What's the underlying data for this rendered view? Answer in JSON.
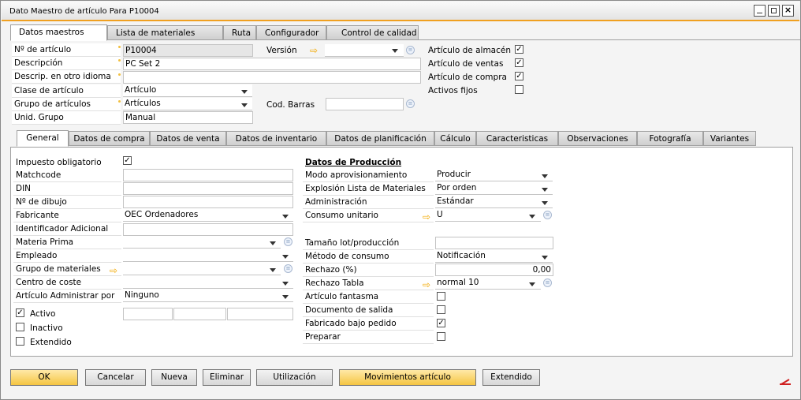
{
  "window": {
    "title": "Dato Maestro de artículo Para P10004"
  },
  "top_tabs": [
    "Datos maestros",
    "Lista de materiales",
    "Ruta",
    "Configurador",
    "Control de calidad"
  ],
  "header": {
    "item_no_label": "Nº de artículo",
    "item_no": "P10004",
    "version_label": "Versión",
    "version": "",
    "desc_label": "Descripción",
    "desc": "PC Set 2",
    "desc_other_label": "Descrip. en otro idioma",
    "desc_other": "",
    "item_class_label": "Clase de artículo",
    "item_class": "Artículo",
    "item_group_label": "Grupo de artículos",
    "item_group": "Artículos",
    "barcode_label": "Cod. Barras",
    "barcode": "",
    "uom_group_label": "Unid. Grupo",
    "uom_group": "Manual",
    "inventory_item_label": "Artículo de almacén",
    "inventory_item": true,
    "sales_item_label": "Artículo de ventas",
    "sales_item": true,
    "purchase_item_label": "Artículo de compra",
    "purchase_item": true,
    "fixed_assets_label": "Activos fijos",
    "fixed_assets": false
  },
  "sub_tabs": [
    "General",
    "Datos de compra",
    "Datos de venta",
    "Datos de inventario",
    "Datos de planificación",
    "Cálculo",
    "Caracteristicas",
    "Observaciones",
    "Fotografía",
    "Variantes"
  ],
  "general": {
    "tax_label": "Impuesto obligatorio",
    "tax": true,
    "matchcode_label": "Matchcode",
    "matchcode": "",
    "din_label": "DIN",
    "din": "",
    "drawing_label": "Nº de dibujo",
    "drawing": "",
    "manufacturer_label": "Fabricante",
    "manufacturer": "OEC Ordenadores",
    "add_id_label": "Identificador Adicional",
    "add_id": "",
    "raw_material_label": "Materia Prima",
    "raw_material": "",
    "employee_label": "Empleado",
    "employee": "",
    "material_group_label": "Grupo de materiales",
    "material_group": "",
    "cost_center_label": "Centro de coste",
    "cost_center": "",
    "manage_by_label": "Artículo Administrar por",
    "manage_by": "Ninguno",
    "active_label": "Activo",
    "active": true,
    "inactive_label": "Inactivo",
    "inactive": false,
    "extended_label": "Extendido",
    "extended": false
  },
  "production": {
    "title": "Datos de Producción",
    "procurement_label": "Modo aprovisionamiento",
    "procurement": "Producir",
    "bom_explosion_label": "Explosión Lista de Materiales",
    "bom_explosion": "Por orden",
    "admin_label": "Administración",
    "admin": "Estándar",
    "unit_consumption_label": "Consumo unitario",
    "unit_consumption": "U",
    "lot_size_label": "Tamaño lot/producción",
    "lot_size": "",
    "consumption_method_label": "Método de consumo",
    "consumption_method": "Notificación",
    "scrap_label": "Rechazo (%)",
    "scrap": "0,00",
    "scrap_table_label": "Rechazo Tabla",
    "scrap_table": "normal 10",
    "phantom_label": "Artículo fantasma",
    "phantom": false,
    "issue_doc_label": "Documento de salida",
    "issue_doc": false,
    "mto_label": "Fabricado bajo pedido",
    "mto": true,
    "prepare_label": "Preparar",
    "prepare": false
  },
  "buttons": {
    "ok": "OK",
    "cancel": "Cancelar",
    "new": "Nueva",
    "delete": "Eliminar",
    "usage": "Utilización",
    "movements": "Movimientos artículo",
    "extended": "Extendido"
  },
  "colors": {
    "accent": "#f0a020",
    "arrow": "#f2a900",
    "tab_bg": "#d9d9d9",
    "button_yellow": "#f5c542"
  }
}
